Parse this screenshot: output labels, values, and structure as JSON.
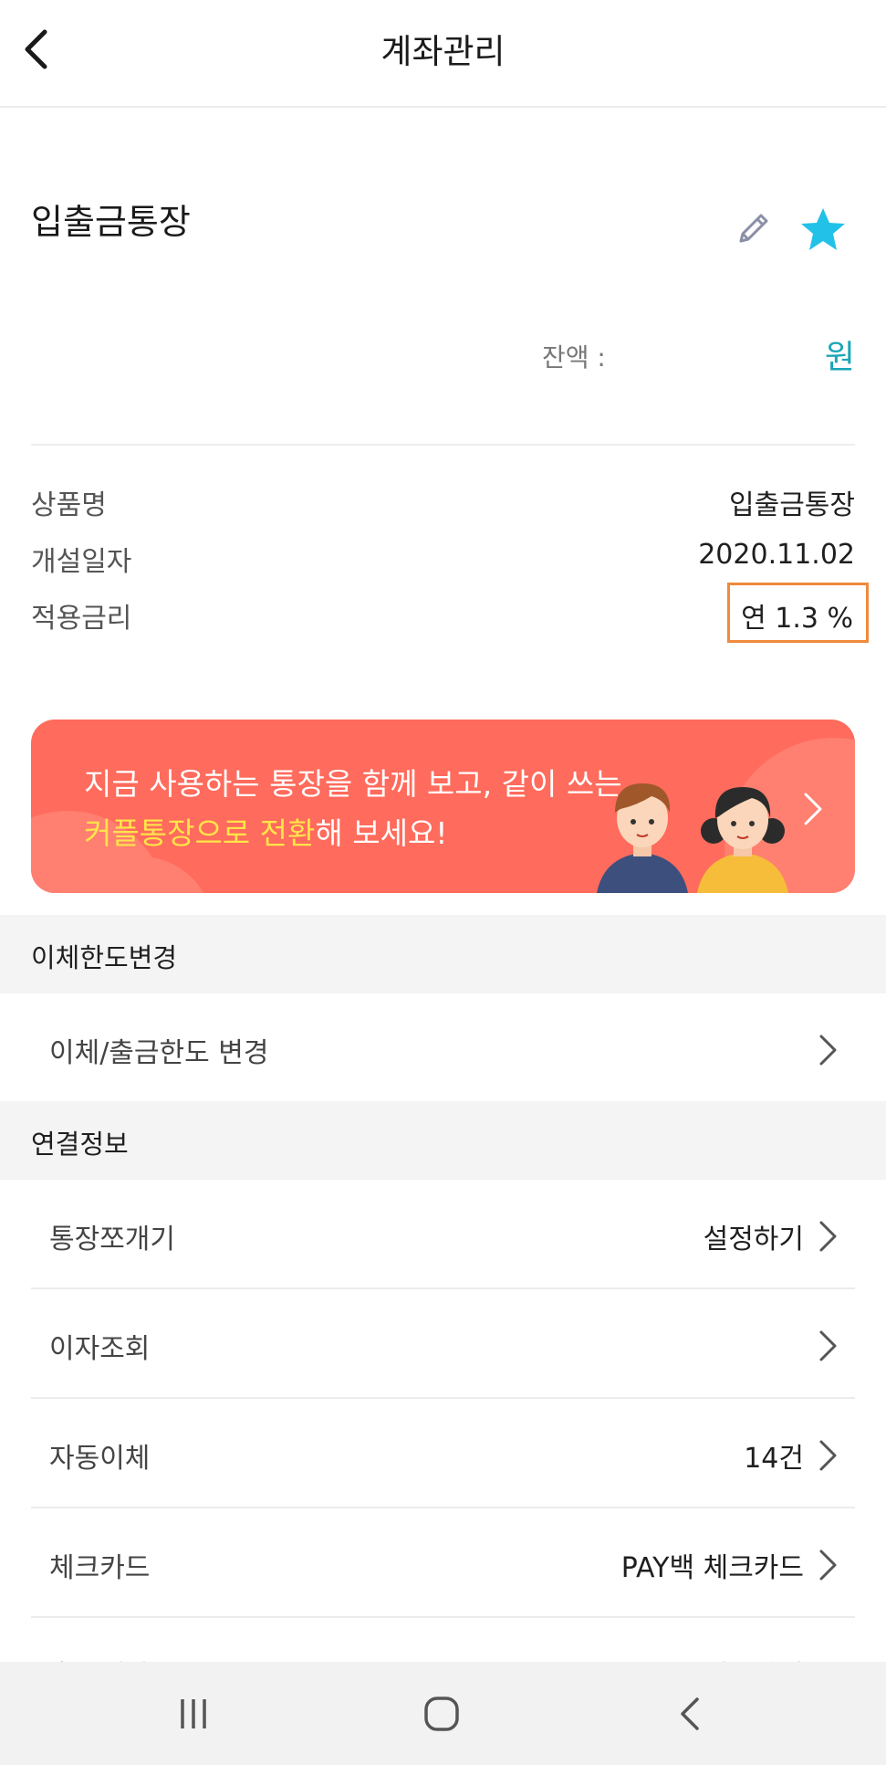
{
  "header": {
    "title": "계좌관리",
    "back_icon": "chevron-left-icon"
  },
  "account": {
    "name": "입출금통장",
    "edit_icon": "pencil-icon",
    "favorite_icon": "star-icon",
    "favorite_color": "#22c1e8",
    "balance_label": "잔액 :",
    "balance_unit": "원",
    "balance_unit_color": "#1aa6b7"
  },
  "details": {
    "product_label": "상품명",
    "product_value": "입출금통장",
    "opened_label": "개설일자",
    "opened_value": "2020.11.02",
    "rate_label": "적용금리",
    "rate_value": "연 1.3 %",
    "rate_highlight_color": "#f08a3c"
  },
  "banner": {
    "line1": "지금 사용하는 통장을 함께 보고, 같이 쓰는",
    "line2_highlight": "커플통장으로 전환",
    "line2_rest": "해 보세요!",
    "background_color": "#ff6b5c",
    "highlight_color": "#ffe449"
  },
  "sections": {
    "limit": {
      "title": "이체한도변경",
      "items": [
        {
          "label": "이체/출금한도 변경",
          "value": ""
        }
      ]
    },
    "linked": {
      "title": "연결정보",
      "items": [
        {
          "label": "통장쪼개기",
          "value": "설정하기"
        },
        {
          "label": "이자조회",
          "value": ""
        },
        {
          "label": "자동이체",
          "value": "14건"
        },
        {
          "label": "체크카드",
          "value": "PAY백 체크카드"
        }
      ]
    }
  },
  "partial_item": {
    "label": "출금계좌",
    "value": "해지하기"
  },
  "system_nav": {
    "recent_icon": "recent-apps-icon",
    "home_icon": "home-icon",
    "back_icon": "back-icon"
  }
}
